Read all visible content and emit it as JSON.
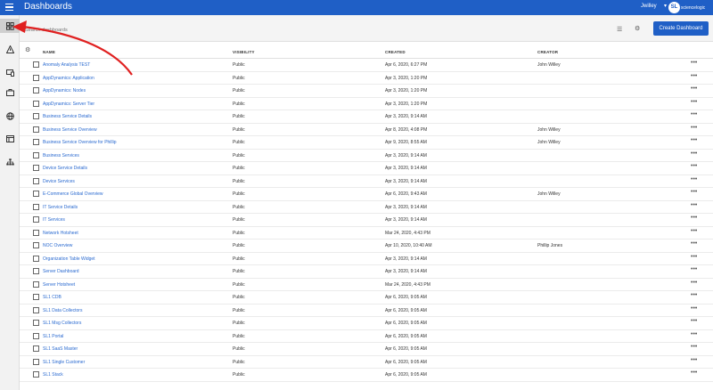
{
  "app": {
    "title": "Dashboards",
    "user": "Jwilley",
    "logo_mark": "SL",
    "logo_text": "sciencelogic"
  },
  "toolbar": {
    "search_placeholder": "Search dashboards",
    "create_label": "Create Dashboard"
  },
  "columns": {
    "name": "NAME",
    "visibility": "VISIBILITY",
    "created": "CREATED",
    "creator": "CREATOR"
  },
  "sidebar_icons": [
    "dashboards-icon",
    "alert-icon",
    "devices-icon",
    "business-services-icon",
    "global-icon",
    "reports-icon",
    "topology-icon"
  ],
  "rows": [
    {
      "name": "Anomaly Analysis TEST",
      "visibility": "Public",
      "created": "Apr 6, 2020, 6:27 PM",
      "creator": "John Willey"
    },
    {
      "name": "AppDynamics: Application",
      "visibility": "Public",
      "created": "Apr 3, 2020, 1:20 PM",
      "creator": ""
    },
    {
      "name": "AppDynamics: Nodes",
      "visibility": "Public",
      "created": "Apr 3, 2020, 1:20 PM",
      "creator": ""
    },
    {
      "name": "AppDynamics: Server Tier",
      "visibility": "Public",
      "created": "Apr 3, 2020, 1:20 PM",
      "creator": ""
    },
    {
      "name": "Business Service Details",
      "visibility": "Public",
      "created": "Apr 3, 2020, 9:14 AM",
      "creator": ""
    },
    {
      "name": "Business Service Overview",
      "visibility": "Public",
      "created": "Apr 8, 2020, 4:08 PM",
      "creator": "John Willey"
    },
    {
      "name": "Business Service Overview for Phillip",
      "visibility": "Public",
      "created": "Apr 9, 2020, 8:55 AM",
      "creator": "John Willey"
    },
    {
      "name": "Business Services",
      "visibility": "Public",
      "created": "Apr 3, 2020, 9:14 AM",
      "creator": ""
    },
    {
      "name": "Device Service Details",
      "visibility": "Public",
      "created": "Apr 3, 2020, 9:14 AM",
      "creator": ""
    },
    {
      "name": "Device Services",
      "visibility": "Public",
      "created": "Apr 3, 2020, 9:14 AM",
      "creator": ""
    },
    {
      "name": "E-Commerce Global Overview",
      "visibility": "Public",
      "created": "Apr 6, 2020, 9:43 AM",
      "creator": "John Willey"
    },
    {
      "name": "IT Service Details",
      "visibility": "Public",
      "created": "Apr 3, 2020, 9:14 AM",
      "creator": ""
    },
    {
      "name": "IT Services",
      "visibility": "Public",
      "created": "Apr 3, 2020, 9:14 AM",
      "creator": ""
    },
    {
      "name": "Network Hotsheet",
      "visibility": "Public",
      "created": "Mar 24, 2020, 4:43 PM",
      "creator": ""
    },
    {
      "name": "NOC Overview",
      "visibility": "Public",
      "created": "Apr 10, 2020, 10:40 AM",
      "creator": "Phillip Jones"
    },
    {
      "name": "Organization Table Widget",
      "visibility": "Public",
      "created": "Apr 3, 2020, 9:14 AM",
      "creator": ""
    },
    {
      "name": "Server Dashboard",
      "visibility": "Public",
      "created": "Apr 3, 2020, 9:14 AM",
      "creator": ""
    },
    {
      "name": "Server Hotsheet",
      "visibility": "Public",
      "created": "Mar 24, 2020, 4:43 PM",
      "creator": ""
    },
    {
      "name": "SL1 CDB",
      "visibility": "Public",
      "created": "Apr 6, 2020, 9:05 AM",
      "creator": ""
    },
    {
      "name": "SL1 Data Collectors",
      "visibility": "Public",
      "created": "Apr 6, 2020, 9:05 AM",
      "creator": ""
    },
    {
      "name": "SL1 Msg Collectors",
      "visibility": "Public",
      "created": "Apr 6, 2020, 9:05 AM",
      "creator": ""
    },
    {
      "name": "SL1 Portal",
      "visibility": "Public",
      "created": "Apr 6, 2020, 9:05 AM",
      "creator": ""
    },
    {
      "name": "SL1 SaaS Master",
      "visibility": "Public",
      "created": "Apr 6, 2020, 9:05 AM",
      "creator": ""
    },
    {
      "name": "SL1 Single Customer",
      "visibility": "Public",
      "created": "Apr 6, 2020, 9:05 AM",
      "creator": ""
    },
    {
      "name": "SL1 Stack",
      "visibility": "Public",
      "created": "Apr 6, 2020, 9:05 AM",
      "creator": ""
    }
  ],
  "colors": {
    "brand": "#1f5fc6",
    "link": "#2a6ad0",
    "annotation_arrow": "#e02020"
  }
}
